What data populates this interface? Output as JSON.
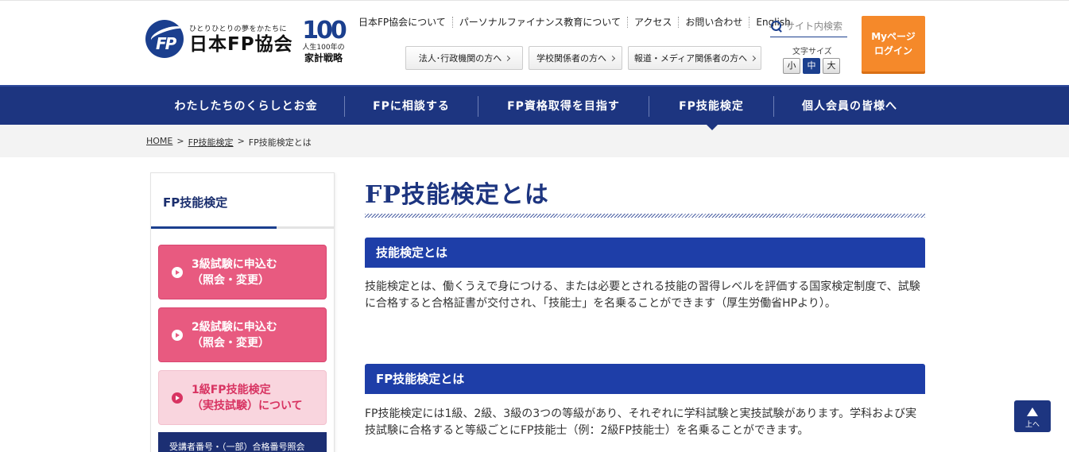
{
  "header": {
    "logo_tagline": "ひとりひとりの夢をかたちに",
    "logo_name": "日本FP協会",
    "badge_number": "100",
    "badge_line1": "人生100年の",
    "badge_line2": "家計戦略",
    "utility_links": [
      "日本FP協会について",
      "パーソナルファイナンス教育について",
      "アクセス",
      "お問い合わせ",
      "English"
    ],
    "audience_buttons": [
      "法人･行政機関の方へ",
      "学校関係者の方へ",
      "報道・メディア関係者の方へ"
    ],
    "search_placeholder": "サイト内検索",
    "font_size_label": "文字サイズ",
    "font_sizes": [
      "小",
      "中",
      "大"
    ],
    "mypage_line1": "Myページ",
    "mypage_line2": "ログイン"
  },
  "gnav": {
    "items": [
      "わたしたちのくらしとお金",
      "FPに相談する",
      "FP資格取得を目指す",
      "FP技能検定",
      "個人会員の皆様へ"
    ],
    "active_index": 3
  },
  "breadcrumb": {
    "home": "HOME",
    "parent": "FP技能検定",
    "current": "FP技能検定とは",
    "separator": ">"
  },
  "sidebar": {
    "title": "FP技能検定",
    "buttons": [
      {
        "line1": "3級試験に申込む",
        "line2": "（照会・変更）"
      },
      {
        "line1": "2級試験に申込む",
        "line2": "（照会・変更）"
      },
      {
        "line1": "1級FP技能検定",
        "line2": "（実技試験）について"
      }
    ],
    "banner": "受講者番号・（一部）合格番号照会"
  },
  "main": {
    "title": "FP技能検定とは",
    "sections": [
      {
        "heading": "技能検定とは",
        "body": "技能検定とは、働くうえで身につける、または必要とされる技能の習得レベルを評価する国家検定制度で、試験に合格すると合格証書が交付され、「技能士」を名乗ることができます（厚生労働省HPより）。"
      },
      {
        "heading": "FP技能検定とは",
        "body": "FP技能検定には1級、2級、3級の3つの等級があり、それぞれに学科試験と実技試験があります。学科および実技試験に合格すると等級ごとにFP技能士（例：2級FP技能士）を名乗ることができます。"
      }
    ]
  },
  "pagetop": {
    "label": "上へ"
  },
  "colors": {
    "navy": "#1d3580",
    "section_blue": "#1e3ea8",
    "pink": "#e85a80",
    "orange": "#f5892a"
  }
}
